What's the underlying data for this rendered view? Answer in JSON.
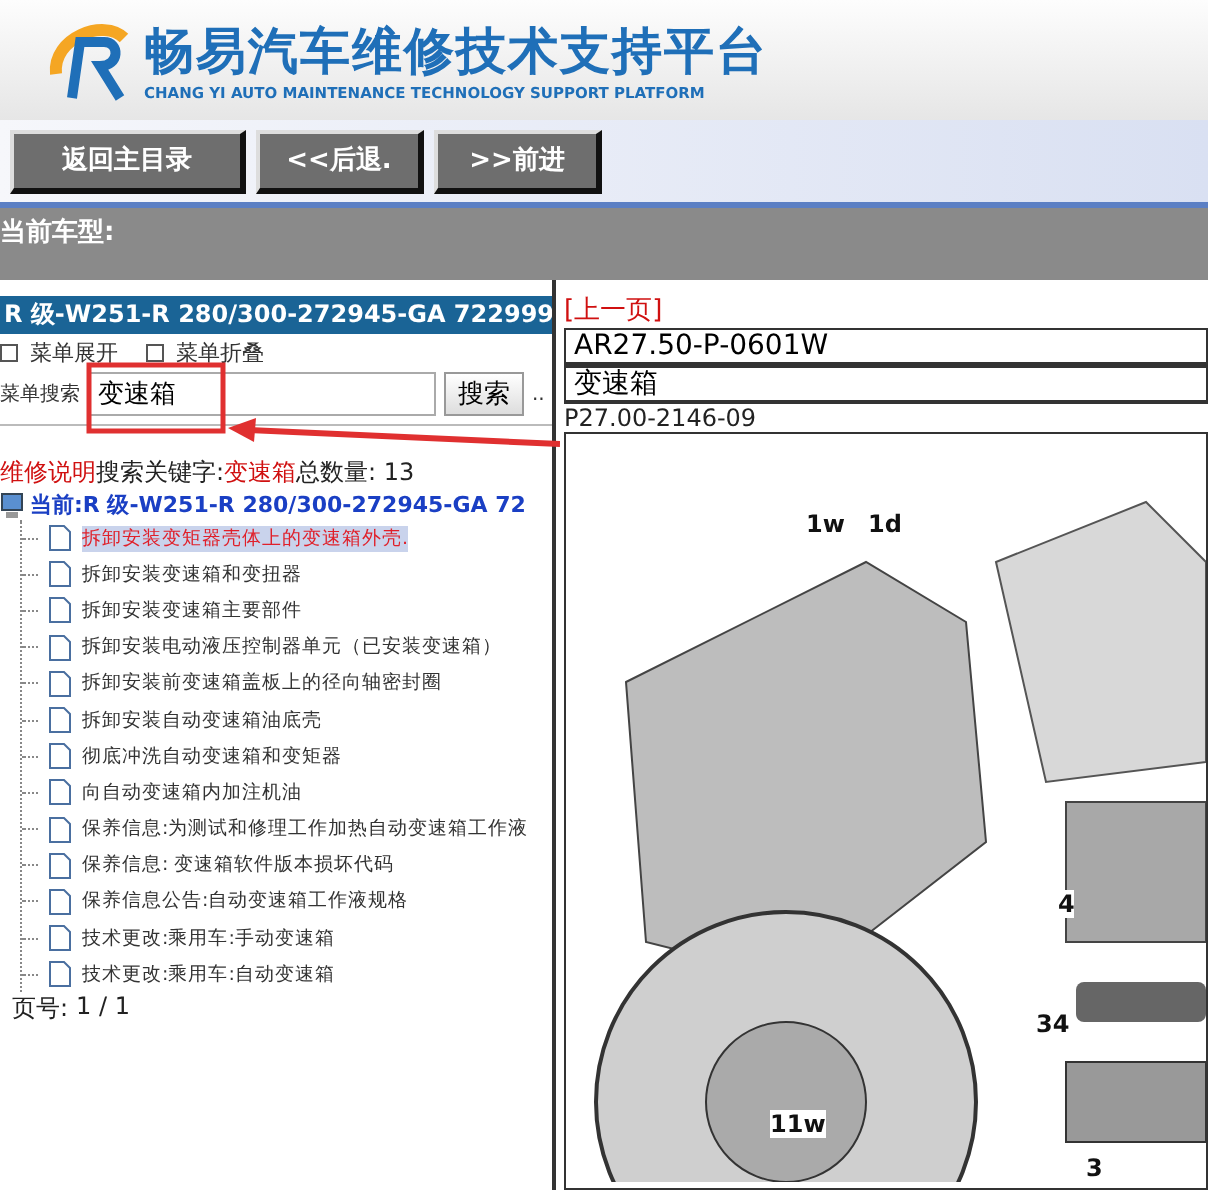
{
  "header": {
    "title": "畅易汽车维修技术支持平台",
    "subtitle": "CHANG YI AUTO MAINTENANCE TECHNOLOGY SUPPORT PLATFORM"
  },
  "nav_buttons": [
    "返回主目录",
    "<<后退.",
    ">>前进"
  ],
  "vehicle_bar": {
    "label": "当前车型:"
  },
  "left_panel": {
    "title": "R 级-W251-R 280/300-272945-GA 722999",
    "menu_toggles": [
      {
        "label": "菜单展开"
      },
      {
        "label": "菜单折叠"
      }
    ],
    "search": {
      "label": "菜单搜索",
      "value": "变速箱",
      "button": "搜索",
      "more": ".."
    },
    "result_line": {
      "category": "维修说明",
      "keyword_label": "搜索关键字:",
      "keyword": "变速箱",
      "count_label": "总数量:",
      "count": "13"
    },
    "tree": {
      "root": "当前:R 级-W251-R 280/300-272945-GA 72",
      "children": [
        {
          "label": "拆卸安装变矩器壳体上的变速箱外壳.",
          "selected": true
        },
        {
          "label": "拆卸安装变速箱和变扭器",
          "selected": false
        },
        {
          "label": "拆卸安装变速箱主要部件",
          "selected": false
        },
        {
          "label": "拆卸安装电动液压控制器单元（已安装变速箱）",
          "selected": false
        },
        {
          "label": "拆卸安装前变速箱盖板上的径向轴密封圈",
          "selected": false
        },
        {
          "label": "拆卸安装自动变速箱油底壳",
          "selected": false
        },
        {
          "label": "彻底冲洗自动变速箱和变矩器",
          "selected": false
        },
        {
          "label": "向自动变速箱内加注机油",
          "selected": false
        },
        {
          "label": "保养信息:为测试和修理工作加热自动变速箱工作液",
          "selected": false
        },
        {
          "label": "保养信息: 变速箱软件版本损坏代码",
          "selected": false
        },
        {
          "label": "保养信息公告:自动变速箱工作液规格",
          "selected": false
        },
        {
          "label": "技术更改:乘用车:手动变速箱",
          "selected": false
        },
        {
          "label": "技术更改:乘用车:自动变速箱",
          "selected": false
        }
      ]
    },
    "pager": {
      "label": "页号:",
      "value": "1 / 1"
    }
  },
  "right_panel": {
    "prev_link": "[上一页]",
    "doc_code": "AR27.50-P-0601W",
    "doc_title": "变速箱",
    "figure_code": "P27.00-2146-09",
    "figure_callouts": [
      "1w",
      "1d",
      "4",
      "34",
      "11w",
      "3"
    ]
  }
}
